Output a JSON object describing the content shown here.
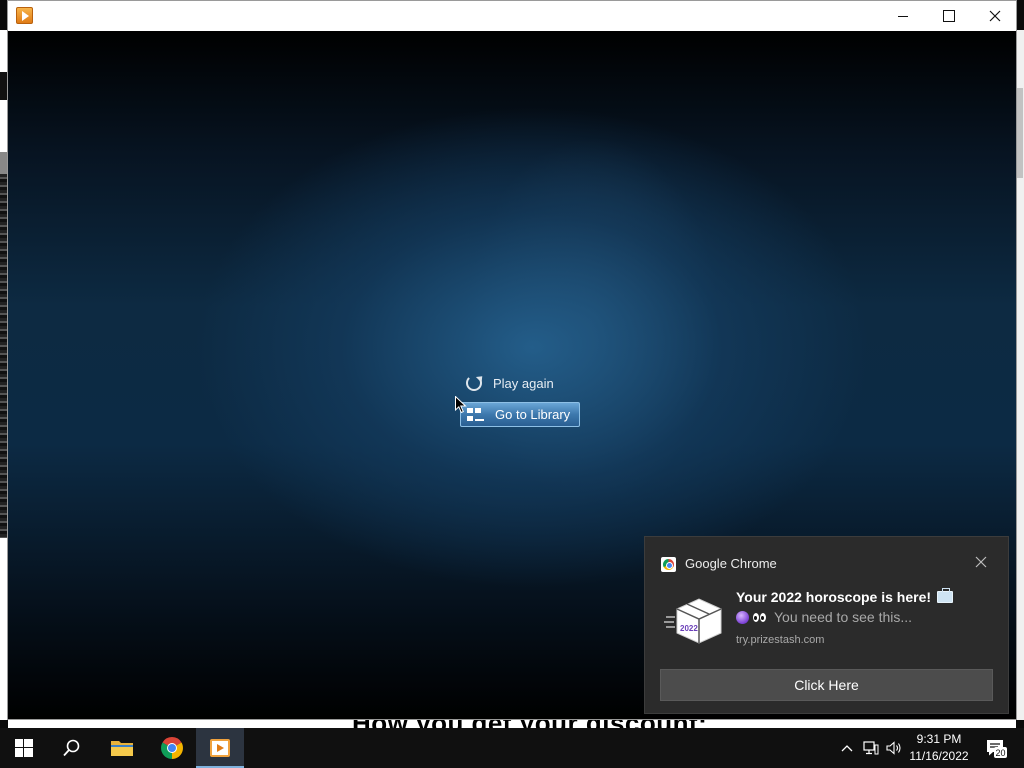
{
  "window": {
    "controls": {
      "minimize": "minimize",
      "maximize": "maximize",
      "close": "close"
    }
  },
  "player": {
    "play_again_label": "Play again",
    "go_to_library_label": "Go to Library"
  },
  "background_page": {
    "partial_text": "How you get your discount:"
  },
  "notification": {
    "app_name": "Google Chrome",
    "title": "Your 2022 horoscope is here!",
    "body": "You need to see this...",
    "url": "try.prizestash.com",
    "action_label": "Click Here",
    "image_label": "2022"
  },
  "taskbar": {
    "items": [
      "start",
      "search",
      "file-explorer",
      "google-chrome",
      "media-player"
    ],
    "active_item": "media-player",
    "clock_time": "9:31 PM",
    "clock_date": "11/16/2022",
    "notification_count": "20"
  },
  "colors": {
    "accent": "#3d78ad",
    "toast_bg": "#2b2b2b",
    "taskbar_bg": "#101010"
  }
}
